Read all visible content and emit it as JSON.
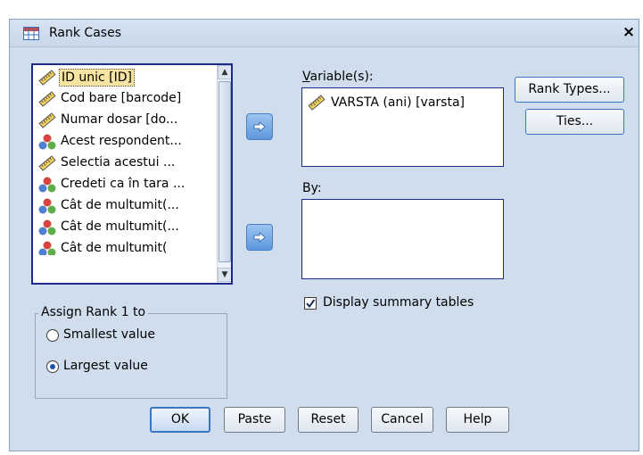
{
  "window": {
    "title": "Rank Cases",
    "close_label": "×"
  },
  "source_list": {
    "items": [
      {
        "label": "ID unic [ID]",
        "icon": "scale-ruler-icon",
        "selected": true
      },
      {
        "label": "Cod bare [barcode]",
        "icon": "scale-ruler-icon"
      },
      {
        "label": "Numar dosar [do...",
        "icon": "scale-ruler-icon"
      },
      {
        "label": "Acest respondent...",
        "icon": "nominal-icon"
      },
      {
        "label": "Selectia acestui ...",
        "icon": "scale-ruler-icon"
      },
      {
        "label": "Credeti ca în tara ...",
        "icon": "nominal-icon"
      },
      {
        "label": "Cât de multumit(...",
        "icon": "nominal-icon"
      },
      {
        "label": "Cât de multumit(...",
        "icon": "nominal-icon"
      },
      {
        "label": "Cât de multumit(",
        "icon": "nominal-icon"
      }
    ]
  },
  "variables": {
    "label": "Variable(s):",
    "items": [
      {
        "label": "VARSTA (ani) [varsta]",
        "icon": "scale-ruler-icon"
      }
    ]
  },
  "by": {
    "label": "By:"
  },
  "side_buttons": {
    "rank_types": "Rank Types...",
    "ties": "Ties..."
  },
  "assign_rank": {
    "title": "Assign Rank 1 to",
    "options": [
      {
        "label": "Smallest value",
        "selected": false
      },
      {
        "label": "Largest value",
        "selected": true
      }
    ]
  },
  "display_summary": {
    "label": "Display summary tables",
    "checked": true
  },
  "footer_buttons": {
    "ok": "OK",
    "paste": "Paste",
    "reset": "Reset",
    "cancel": "Cancel",
    "help": "Help"
  },
  "colors": {
    "dialog_bg": "#cfdded",
    "selection_bg": "#f5e39f",
    "list_border": "#1c2a8c",
    "arrow_button": "#5d97dc"
  }
}
